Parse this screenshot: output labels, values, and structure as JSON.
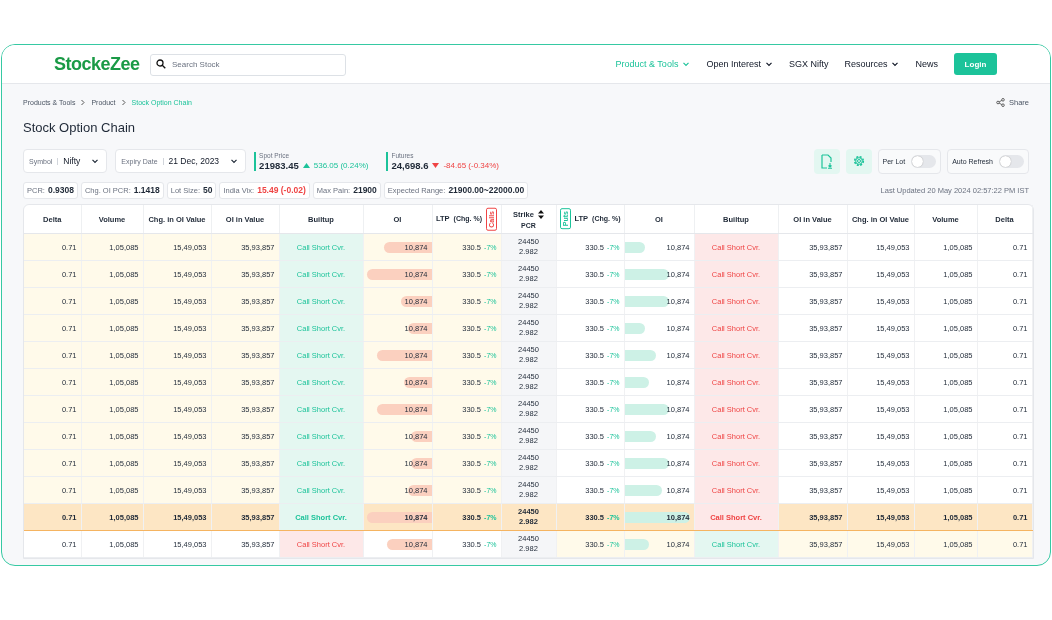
{
  "header": {
    "logo": "StockeZee",
    "search": {
      "placeholder": "Search Stock"
    },
    "nav": [
      {
        "label": "Product & Tools",
        "selected": true,
        "dropdown": true
      },
      {
        "label": "Open Interest",
        "selected": false,
        "dropdown": true
      },
      {
        "label": "SGX Nifty",
        "selected": false,
        "dropdown": false
      },
      {
        "label": "Resources",
        "selected": false,
        "dropdown": true
      },
      {
        "label": "News",
        "selected": false,
        "dropdown": false
      }
    ],
    "login": "Login"
  },
  "breadcrumb": [
    {
      "label": "Products & Tools",
      "selected": false
    },
    {
      "label": "Product",
      "selected": false
    },
    {
      "label": "Stock Option Chain",
      "selected": true
    }
  ],
  "share": "Share",
  "title": "Stock Option Chain",
  "selects": [
    {
      "label": "Symbol",
      "value": "Nifty"
    },
    {
      "label": "Expiry Date",
      "value": "21 Dec, 2023"
    }
  ],
  "quotes": [
    {
      "label": "Spot Price",
      "value": "21983.45",
      "change": "536.05 (0.24%)",
      "kind": "up"
    },
    {
      "label": "Futures",
      "value": "24,698.6",
      "change": "-84.65 (-0.34%)",
      "kind": "down"
    }
  ],
  "toggles": [
    {
      "label": "Per Lot",
      "on": false
    },
    {
      "label": "Auto Refresh",
      "on": false
    }
  ],
  "stats": [
    {
      "label": "PCR:",
      "value": "0.9308",
      "color": "#1f2937"
    },
    {
      "label": "Chg. OI PCR:",
      "value": "1.1418",
      "color": "#1f2937"
    },
    {
      "label": "Lot Size:",
      "value": "50",
      "color": "#1f2937"
    },
    {
      "label": "India Vix:",
      "value": "15.49 (-0.02)",
      "color": "#ef4444"
    },
    {
      "label": "Max Pain:",
      "value": "21900",
      "color": "#1f2937"
    },
    {
      "label": "Expected Range:",
      "value": "21900.00~22000.00",
      "color": "#1f2937"
    }
  ],
  "last_updated": "Last Updated 20 May 2024 02:57:22 PM IST",
  "table": {
    "call_columns": [
      "Delta",
      "Volume",
      "Chg. in OI Value",
      "OI in Value",
      "Builtup",
      "OI",
      "LTP"
    ],
    "calls_chg_label": "(Chg. %)",
    "puts_chg_label": "(Chg. %)",
    "calls_tag": "Calls",
    "puts_tag": "Puts",
    "strike_label": "Strike",
    "pcr_label": "PCR",
    "put_columns": [
      "LTP",
      "OI",
      "Builtup",
      "OI in Value",
      "Chg. in OI Value",
      "Volume",
      "Delta"
    ],
    "rows": [
      {
        "kind": "itm_call",
        "strike": "24450",
        "pcr": "2.982",
        "calls": {
          "delta": "0.71",
          "volume": "1,05,085",
          "chg_oi_value": "15,49,053",
          "oi_value": "35,93,857",
          "builtup": {
            "text": "Call Short Cvr.",
            "kind": "positive"
          },
          "oi": "10,874",
          "level": 0.7,
          "ltp": "330.5",
          "chg": "-7%"
        },
        "puts": {
          "ltp": "330.5",
          "chg": "-7%",
          "oi": "10,874",
          "level": 0.3,
          "builtup": {
            "text": "Call Short Cvr.",
            "kind": "negative"
          },
          "oi_value": "35,93,857",
          "chg_oi_value": "15,49,053",
          "volume": "1,05,085",
          "delta": "0.71"
        }
      },
      {
        "kind": "itm_call",
        "strike": "24450",
        "pcr": "2.982",
        "calls": {
          "delta": "0.71",
          "volume": "1,05,085",
          "chg_oi_value": "15,49,053",
          "oi_value": "35,93,857",
          "builtup": {
            "text": "Call Short Cvr.",
            "kind": "positive"
          },
          "oi": "10,874",
          "level": 0.95,
          "ltp": "330.5",
          "chg": "-7%"
        },
        "puts": {
          "ltp": "330.5",
          "chg": "-7%",
          "oi": "10,874",
          "level": 0.65,
          "builtup": {
            "text": "Call Short Cvr.",
            "kind": "negative"
          },
          "oi_value": "35,93,857",
          "chg_oi_value": "15,49,053",
          "volume": "1,05,085",
          "delta": "0.71"
        }
      },
      {
        "kind": "itm_call",
        "strike": "24450",
        "pcr": "2.982",
        "calls": {
          "delta": "0.71",
          "volume": "1,05,085",
          "chg_oi_value": "15,49,053",
          "oi_value": "35,93,857",
          "builtup": {
            "text": "Call Short Cvr.",
            "kind": "positive"
          },
          "oi": "10,874",
          "level": 0.45,
          "ltp": "330.5",
          "chg": "-7%"
        },
        "puts": {
          "ltp": "330.5",
          "chg": "-7%",
          "oi": "10,874",
          "level": 0.65,
          "builtup": {
            "text": "Call Short Cvr.",
            "kind": "negative"
          },
          "oi_value": "35,93,857",
          "chg_oi_value": "15,49,053",
          "volume": "1,05,085",
          "delta": "0.71"
        }
      },
      {
        "kind": "itm_call",
        "strike": "24450",
        "pcr": "2.982",
        "calls": {
          "delta": "0.71",
          "volume": "1,05,085",
          "chg_oi_value": "15,49,053",
          "oi_value": "35,93,857",
          "builtup": {
            "text": "Call Short Cvr.",
            "kind": "positive"
          },
          "oi": "10,874",
          "level": 0.35,
          "ltp": "330.5",
          "chg": "-7%"
        },
        "puts": {
          "ltp": "330.5",
          "chg": "-7%",
          "oi": "10,874",
          "level": 0.3,
          "builtup": {
            "text": "Call Short Cvr.",
            "kind": "negative"
          },
          "oi_value": "35,93,857",
          "chg_oi_value": "15,49,053",
          "volume": "1,05,085",
          "delta": "0.71"
        }
      },
      {
        "kind": "itm_call",
        "strike": "24450",
        "pcr": "2.982",
        "calls": {
          "delta": "0.71",
          "volume": "1,05,085",
          "chg_oi_value": "15,49,053",
          "oi_value": "35,93,857",
          "builtup": {
            "text": "Call Short Cvr.",
            "kind": "positive"
          },
          "oi": "10,874",
          "level": 0.8,
          "ltp": "330.5",
          "chg": "-7%"
        },
        "puts": {
          "ltp": "330.5",
          "chg": "-7%",
          "oi": "10,874",
          "level": 0.45,
          "builtup": {
            "text": "Call Short Cvr.",
            "kind": "negative"
          },
          "oi_value": "35,93,857",
          "chg_oi_value": "15,49,053",
          "volume": "1,05,085",
          "delta": "0.71"
        }
      },
      {
        "kind": "itm_call",
        "strike": "24450",
        "pcr": "2.982",
        "calls": {
          "delta": "0.71",
          "volume": "1,05,085",
          "chg_oi_value": "15,49,053",
          "oi_value": "35,93,857",
          "builtup": {
            "text": "Call Short Cvr.",
            "kind": "positive"
          },
          "oi": "10,874",
          "level": 0.4,
          "ltp": "330.5",
          "chg": "-7%"
        },
        "puts": {
          "ltp": "330.5",
          "chg": "-7%",
          "oi": "10,874",
          "level": 0.35,
          "builtup": {
            "text": "Call Short Cvr.",
            "kind": "negative"
          },
          "oi_value": "35,93,857",
          "chg_oi_value": "15,49,053",
          "volume": "1,05,085",
          "delta": "0.71"
        }
      },
      {
        "kind": "itm_call",
        "strike": "24450",
        "pcr": "2.982",
        "calls": {
          "delta": "0.71",
          "volume": "1,05,085",
          "chg_oi_value": "15,49,053",
          "oi_value": "35,93,857",
          "builtup": {
            "text": "Call Short Cvr.",
            "kind": "positive"
          },
          "oi": "10,874",
          "level": 0.8,
          "ltp": "330.5",
          "chg": "-7%"
        },
        "puts": {
          "ltp": "330.5",
          "chg": "-7%",
          "oi": "10,874",
          "level": 0.65,
          "builtup": {
            "text": "Call Short Cvr.",
            "kind": "negative"
          },
          "oi_value": "35,93,857",
          "chg_oi_value": "15,49,053",
          "volume": "1,05,085",
          "delta": "0.71"
        }
      },
      {
        "kind": "itm_call",
        "strike": "24450",
        "pcr": "2.982",
        "calls": {
          "delta": "0.71",
          "volume": "1,05,085",
          "chg_oi_value": "15,49,053",
          "oi_value": "35,93,857",
          "builtup": {
            "text": "Call Short Cvr.",
            "kind": "positive"
          },
          "oi": "10,874",
          "level": 0.3,
          "ltp": "330.5",
          "chg": "-7%"
        },
        "puts": {
          "ltp": "330.5",
          "chg": "-7%",
          "oi": "10,874",
          "level": 0.45,
          "builtup": {
            "text": "Call Short Cvr.",
            "kind": "negative"
          },
          "oi_value": "35,93,857",
          "chg_oi_value": "15,49,053",
          "volume": "1,05,085",
          "delta": "0.71"
        }
      },
      {
        "kind": "itm_call",
        "strike": "24450",
        "pcr": "2.982",
        "calls": {
          "delta": "0.71",
          "volume": "1,05,085",
          "chg_oi_value": "15,49,053",
          "oi_value": "35,93,857",
          "builtup": {
            "text": "Call Short Cvr.",
            "kind": "positive"
          },
          "oi": "10,874",
          "level": 0.3,
          "ltp": "330.5",
          "chg": "-7%"
        },
        "puts": {
          "ltp": "330.5",
          "chg": "-7%",
          "oi": "10,874",
          "level": 0.65,
          "builtup": {
            "text": "Call Short Cvr.",
            "kind": "negative"
          },
          "oi_value": "35,93,857",
          "chg_oi_value": "15,49,053",
          "volume": "1,05,085",
          "delta": "0.71"
        }
      },
      {
        "kind": "itm_call",
        "strike": "24450",
        "pcr": "2.982",
        "calls": {
          "delta": "0.71",
          "volume": "1,05,085",
          "chg_oi_value": "15,49,053",
          "oi_value": "35,93,857",
          "builtup": {
            "text": "Call Short Cvr.",
            "kind": "positive"
          },
          "oi": "10,874",
          "level": 0.35,
          "ltp": "330.5",
          "chg": "-7%"
        },
        "puts": {
          "ltp": "330.5",
          "chg": "-7%",
          "oi": "10,874",
          "level": 0.55,
          "builtup": {
            "text": "Call Short Cvr.",
            "kind": "negative"
          },
          "oi_value": "35,93,857",
          "chg_oi_value": "15,49,053",
          "volume": "1,05,085",
          "delta": "0.71"
        }
      },
      {
        "kind": "atm",
        "strike": "24450",
        "pcr": "2.982",
        "calls": {
          "delta": "0.71",
          "volume": "1,05,085",
          "chg_oi_value": "15,49,053",
          "oi_value": "35,93,857",
          "builtup": {
            "text": "Call Short Cvr.",
            "kind": "positive"
          },
          "oi": "10,874",
          "level": 0.95,
          "ltp": "330.5",
          "chg": "-7%"
        },
        "puts": {
          "ltp": "330.5",
          "chg": "-7%",
          "oi": "10,874",
          "level": 0.95,
          "builtup": {
            "text": "Call Short Cvr.",
            "kind": "negative"
          },
          "oi_value": "35,93,857",
          "chg_oi_value": "15,49,053",
          "volume": "1,05,085",
          "delta": "0.71"
        }
      },
      {
        "kind": "itm_put",
        "strike": "24450",
        "pcr": "2.982",
        "calls": {
          "delta": "0.71",
          "volume": "1,05,085",
          "chg_oi_value": "15,49,053",
          "oi_value": "35,93,857",
          "builtup": {
            "text": "Call Short Cvr.",
            "kind": "negative"
          },
          "oi": "10,874",
          "level": 0.65,
          "ltp": "330.5",
          "chg": "-7%"
        },
        "puts": {
          "ltp": "330.5",
          "chg": "-7%",
          "oi": "10,874",
          "level": 0.35,
          "builtup": {
            "text": "Call Short Cvr.",
            "kind": "positive"
          },
          "oi_value": "35,93,857",
          "chg_oi_value": "15,49,053",
          "volume": "1,05,085",
          "delta": "0.71"
        }
      }
    ]
  }
}
